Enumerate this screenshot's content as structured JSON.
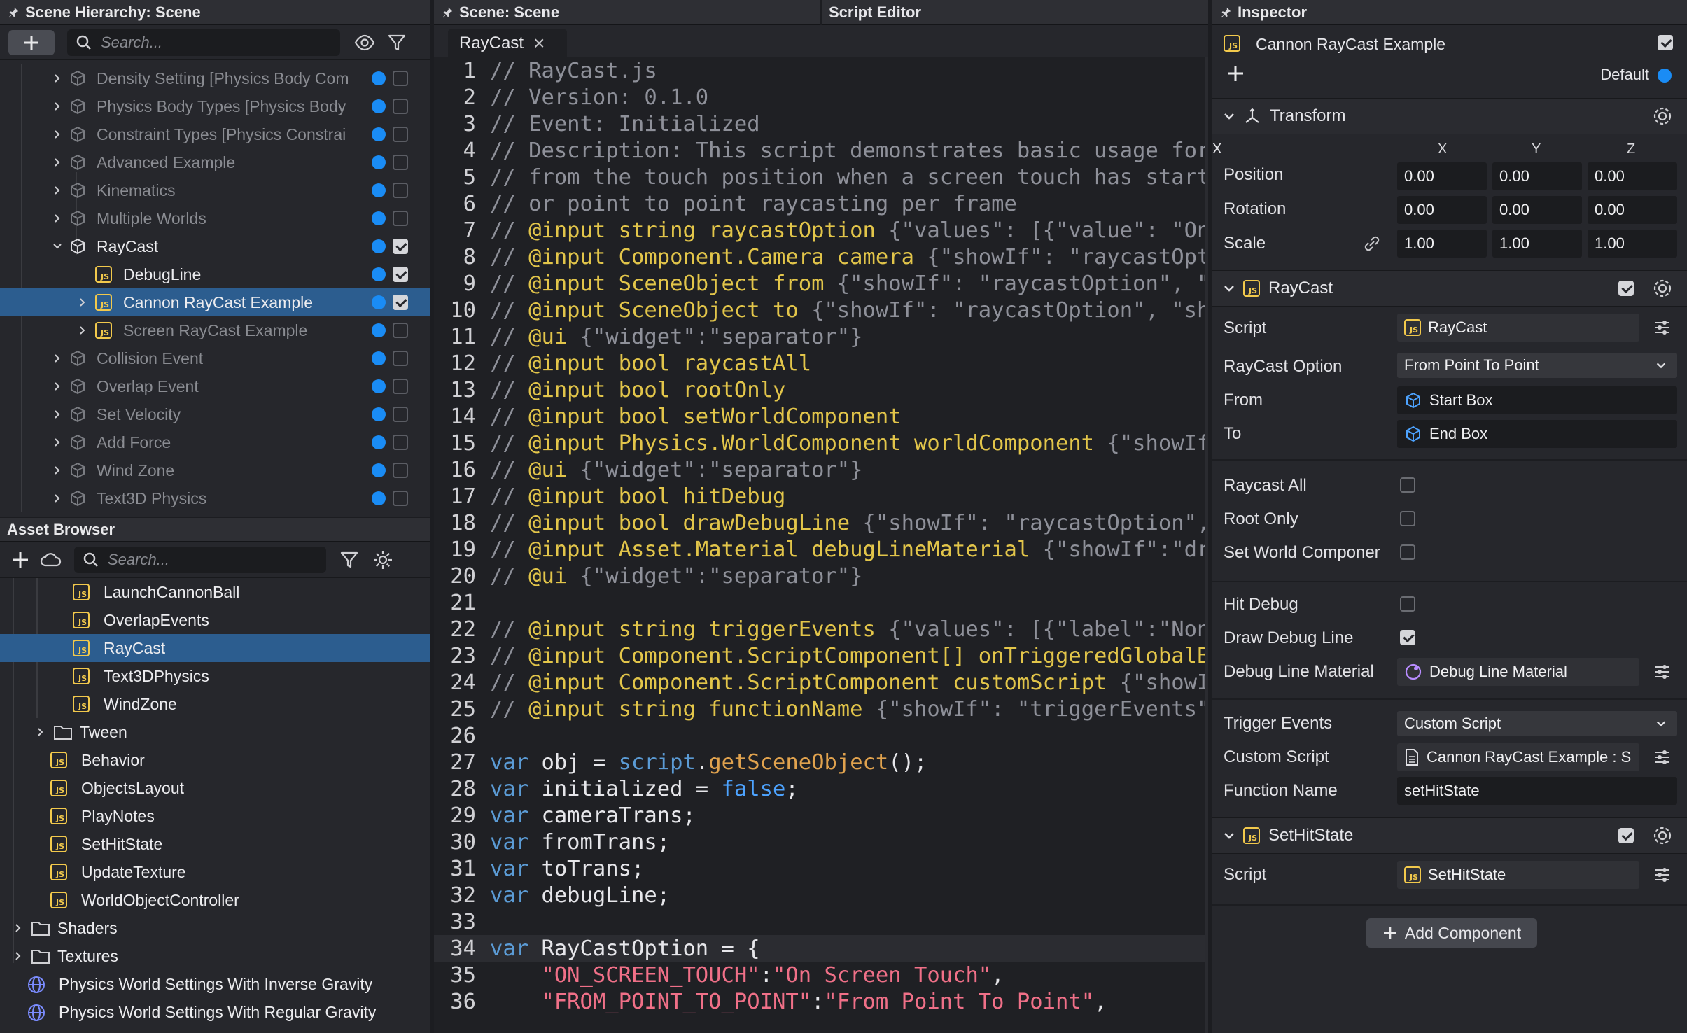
{
  "hierarchy": {
    "title": "Scene Hierarchy: Scene",
    "search_placeholder": "Search...",
    "items": [
      {
        "label": "Density Setting [Physics Body Com",
        "enabled": false
      },
      {
        "label": "Physics Body Types [Physics Body",
        "enabled": false
      },
      {
        "label": "Constraint Types [Physics Constrai",
        "enabled": false
      },
      {
        "label": "Advanced Example",
        "enabled": false
      },
      {
        "label": "Kinematics",
        "enabled": false
      },
      {
        "label": "Multiple Worlds",
        "enabled": false
      },
      {
        "label": "RayCast",
        "enabled": true
      },
      {
        "label": "DebugLine",
        "enabled": true
      },
      {
        "label": "Cannon RayCast Example",
        "enabled": true
      },
      {
        "label": "Screen RayCast Example",
        "enabled": false
      },
      {
        "label": "Collision Event",
        "enabled": false
      },
      {
        "label": "Overlap Event",
        "enabled": false
      },
      {
        "label": "Set Velocity",
        "enabled": false
      },
      {
        "label": "Add Force",
        "enabled": false
      },
      {
        "label": "Wind Zone",
        "enabled": false
      },
      {
        "label": "Text3D Physics",
        "enabled": false
      }
    ]
  },
  "assets": {
    "title": "Asset Browser",
    "search_placeholder": "Search...",
    "items": [
      {
        "label": "LaunchCannonBall",
        "icon": "js-icon"
      },
      {
        "label": "OverlapEvents",
        "icon": "js-icon"
      },
      {
        "label": "RayCast",
        "icon": "js-icon"
      },
      {
        "label": "Text3DPhysics",
        "icon": "js-icon"
      },
      {
        "label": "WindZone",
        "icon": "js-icon"
      },
      {
        "label": "Tween",
        "icon": "folder-icon"
      },
      {
        "label": "Behavior",
        "icon": "js-icon"
      },
      {
        "label": "ObjectsLayout",
        "icon": "js-icon"
      },
      {
        "label": "PlayNotes",
        "icon": "js-icon"
      },
      {
        "label": "SetHitState",
        "icon": "js-icon"
      },
      {
        "label": "UpdateTexture",
        "icon": "js-icon"
      },
      {
        "label": "WorldObjectController",
        "icon": "js-icon"
      },
      {
        "label": "Shaders",
        "icon": "folder-icon"
      },
      {
        "label": "Textures",
        "icon": "folder-icon"
      },
      {
        "label": "Physics World Settings With Inverse Gravity",
        "icon": "world-settings-icon"
      },
      {
        "label": "Physics World Settings With Regular Gravity",
        "icon": "world-settings-icon"
      }
    ]
  },
  "editor": {
    "tab_scene": "Scene: Scene",
    "tab_script": "Script Editor",
    "file_tab": "RayCast",
    "close_glyph": "×",
    "lines": [
      {
        "n": "1",
        "parts": [
          [
            "c-cm",
            "// RayCast.js"
          ]
        ]
      },
      {
        "n": "2",
        "parts": [
          [
            "c-cm",
            "// Version: 0.1.0"
          ]
        ]
      },
      {
        "n": "3",
        "parts": [
          [
            "c-cm",
            "// Event: Initialized"
          ]
        ]
      },
      {
        "n": "4",
        "parts": [
          [
            "c-cm",
            "// Description: This script demonstrates basic usage for"
          ]
        ]
      },
      {
        "n": "5",
        "parts": [
          [
            "c-cm",
            "// from the touch position when a screen touch has started"
          ]
        ]
      },
      {
        "n": "6",
        "parts": [
          [
            "c-cm",
            "// or point to point raycasting per frame"
          ]
        ]
      },
      {
        "n": "7",
        "parts": [
          [
            "c-cm",
            "// "
          ],
          [
            "c-yl",
            "@input string raycastOption "
          ],
          [
            "c-cm",
            "{\"values\": [{\"value\": \"On Scre"
          ]
        ]
      },
      {
        "n": "8",
        "parts": [
          [
            "c-cm",
            "// "
          ],
          [
            "c-yl",
            "@input Component.Camera camera "
          ],
          [
            "c-cm",
            "{\"showIf\": \"raycastOption\""
          ]
        ]
      },
      {
        "n": "9",
        "parts": [
          [
            "c-cm",
            "// "
          ],
          [
            "c-yl",
            "@input SceneObject from "
          ],
          [
            "c-cm",
            "{\"showIf\": \"raycastOption\", \"showI"
          ]
        ]
      },
      {
        "n": "10",
        "parts": [
          [
            "c-cm",
            "// "
          ],
          [
            "c-yl",
            "@input SceneObject to "
          ],
          [
            "c-cm",
            "{\"showIf\": \"raycastOption\", \"showIf\""
          ]
        ]
      },
      {
        "n": "11",
        "parts": [
          [
            "c-cm",
            "// "
          ],
          [
            "c-yl",
            "@ui "
          ],
          [
            "c-cm",
            "{\"widget\":\"separator\"}"
          ]
        ]
      },
      {
        "n": "12",
        "parts": [
          [
            "c-cm",
            "// "
          ],
          [
            "c-yl",
            "@input bool raycastAll"
          ]
        ]
      },
      {
        "n": "13",
        "parts": [
          [
            "c-cm",
            "// "
          ],
          [
            "c-yl",
            "@input bool rootOnly"
          ]
        ]
      },
      {
        "n": "14",
        "parts": [
          [
            "c-cm",
            "// "
          ],
          [
            "c-yl",
            "@input bool setWorldComponent"
          ]
        ]
      },
      {
        "n": "15",
        "parts": [
          [
            "c-cm",
            "// "
          ],
          [
            "c-yl",
            "@input Physics.WorldComponent worldComponent "
          ],
          [
            "c-cm",
            "{\"showIf\":\"se"
          ]
        ]
      },
      {
        "n": "16",
        "parts": [
          [
            "c-cm",
            "// "
          ],
          [
            "c-yl",
            "@ui "
          ],
          [
            "c-cm",
            "{\"widget\":\"separator\"}"
          ]
        ]
      },
      {
        "n": "17",
        "parts": [
          [
            "c-cm",
            "// "
          ],
          [
            "c-yl",
            "@input bool hitDebug"
          ]
        ]
      },
      {
        "n": "18",
        "parts": [
          [
            "c-cm",
            "// "
          ],
          [
            "c-yl",
            "@input bool drawDebugLine "
          ],
          [
            "c-cm",
            "{\"showIf\": \"raycastOption\", \"sho"
          ]
        ]
      },
      {
        "n": "19",
        "parts": [
          [
            "c-cm",
            "// "
          ],
          [
            "c-yl",
            "@input Asset.Material debugLineMaterial "
          ],
          [
            "c-cm",
            "{\"showIf\":\"drawDeb"
          ]
        ]
      },
      {
        "n": "20",
        "parts": [
          [
            "c-cm",
            "// "
          ],
          [
            "c-yl",
            "@ui "
          ],
          [
            "c-cm",
            "{\"widget\":\"separator\"}"
          ]
        ]
      },
      {
        "n": "21",
        "parts": []
      },
      {
        "n": "22",
        "parts": [
          [
            "c-cm",
            "// "
          ],
          [
            "c-yl",
            "@input string triggerEvents "
          ],
          [
            "c-cm",
            "{\"values\": [{\"label\":\"None\", \""
          ]
        ]
      },
      {
        "n": "23",
        "parts": [
          [
            "c-cm",
            "// "
          ],
          [
            "c-yl",
            "@input Component.ScriptComponent[] onTriggeredGlobalBehav"
          ]
        ]
      },
      {
        "n": "24",
        "parts": [
          [
            "c-cm",
            "// "
          ],
          [
            "c-yl",
            "@input Component.ScriptComponent customScript "
          ],
          [
            "c-cm",
            "{\"showIf\": \""
          ]
        ]
      },
      {
        "n": "25",
        "parts": [
          [
            "c-cm",
            "// "
          ],
          [
            "c-yl",
            "@input string functionName "
          ],
          [
            "c-cm",
            "{\"showIf\": \"triggerEvents\", \"sh"
          ]
        ]
      },
      {
        "n": "26",
        "parts": []
      },
      {
        "n": "27",
        "parts": [
          [
            "c-kw",
            "var "
          ],
          [
            "c-wh",
            "obj = "
          ],
          [
            "c-kw",
            "script"
          ],
          [
            "c-wh",
            "."
          ],
          [
            "c-fn",
            "getSceneObject"
          ],
          [
            "c-wh",
            "();"
          ]
        ]
      },
      {
        "n": "28",
        "parts": [
          [
            "c-kw",
            "var "
          ],
          [
            "c-wh",
            "initialized = "
          ],
          [
            "c-bl",
            "false"
          ],
          [
            "c-wh",
            ";"
          ]
        ]
      },
      {
        "n": "29",
        "parts": [
          [
            "c-kw",
            "var "
          ],
          [
            "c-wh",
            "cameraTrans;"
          ]
        ]
      },
      {
        "n": "30",
        "parts": [
          [
            "c-kw",
            "var "
          ],
          [
            "c-wh",
            "fromTrans;"
          ]
        ]
      },
      {
        "n": "31",
        "parts": [
          [
            "c-kw",
            "var "
          ],
          [
            "c-wh",
            "toTrans;"
          ]
        ]
      },
      {
        "n": "32",
        "parts": [
          [
            "c-kw",
            "var "
          ],
          [
            "c-wh",
            "debugLine;"
          ]
        ]
      },
      {
        "n": "33",
        "parts": []
      },
      {
        "n": "34",
        "parts": [
          [
            "c-kw",
            "var "
          ],
          [
            "c-wh",
            "RayCastOption = {"
          ]
        ]
      },
      {
        "n": "35",
        "parts": [
          [
            "c-st",
            "    \"ON_SCREEN_TOUCH\""
          ],
          [
            "c-wh",
            ":"
          ],
          [
            "c-st",
            "\"On Screen Touch\""
          ],
          [
            "c-wh",
            ","
          ]
        ]
      },
      {
        "n": "36",
        "parts": [
          [
            "c-st",
            "    \"FROM_POINT_TO_POINT\""
          ],
          [
            "c-wh",
            ":"
          ],
          [
            "c-st",
            "\"From Point To Point\""
          ],
          [
            "c-wh",
            ","
          ]
        ]
      }
    ]
  },
  "inspector": {
    "title": "Inspector",
    "object_name": "Cannon RayCast Example",
    "layer": "Default",
    "transform": {
      "title": "Transform",
      "axes": [
        "X",
        "Y",
        "Z"
      ],
      "position_label": "Position",
      "rotation_label": "Rotation",
      "scale_label": "Scale",
      "position": [
        "0.00",
        "0.00",
        "0.00"
      ],
      "rotation": [
        "0.00",
        "0.00",
        "0.00"
      ],
      "scale": [
        "1.00",
        "1.00",
        "1.00"
      ]
    },
    "raycast": {
      "title": "RayCast",
      "script_label": "Script",
      "script_value": "RayCast",
      "option_label": "RayCast Option",
      "option_value": "From Point To Point",
      "from_label": "From",
      "from_value": "Start Box",
      "to_label": "To",
      "to_value": "End Box",
      "raycast_all_label": "Raycast All",
      "root_only_label": "Root Only",
      "set_world_label": "Set World Componer",
      "hit_debug_label": "Hit Debug",
      "draw_debug_label": "Draw Debug Line",
      "debug_mat_label": "Debug Line Material",
      "debug_mat_value": "Debug Line Material",
      "trigger_label": "Trigger Events",
      "trigger_value": "Custom Script",
      "custom_label": "Custom Script",
      "custom_value": "Cannon RayCast Example : S",
      "func_label": "Function Name",
      "func_value": "setHitState"
    },
    "sethit": {
      "title": "SetHitState",
      "script_label": "Script",
      "script_value": "SetHitState"
    },
    "add_component": "Add Component"
  }
}
